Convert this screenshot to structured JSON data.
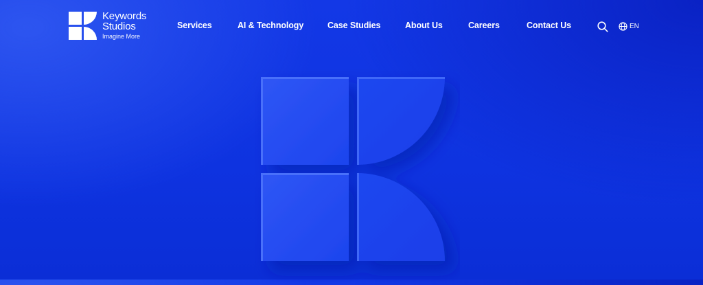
{
  "brand": {
    "name_line1": "Keywords",
    "name_line2": "Studios",
    "tagline": "Imagine More"
  },
  "nav": {
    "items": [
      {
        "label": "Services"
      },
      {
        "label": "AI & Technology"
      },
      {
        "label": "Case Studies"
      },
      {
        "label": "About Us"
      },
      {
        "label": "Careers"
      },
      {
        "label": "Contact Us"
      }
    ]
  },
  "header_actions": {
    "search_icon": "search-icon",
    "language_icon": "globe-icon",
    "language": "EN"
  },
  "colors": {
    "background": "#0e33e0",
    "foreground": "#ffffff"
  }
}
